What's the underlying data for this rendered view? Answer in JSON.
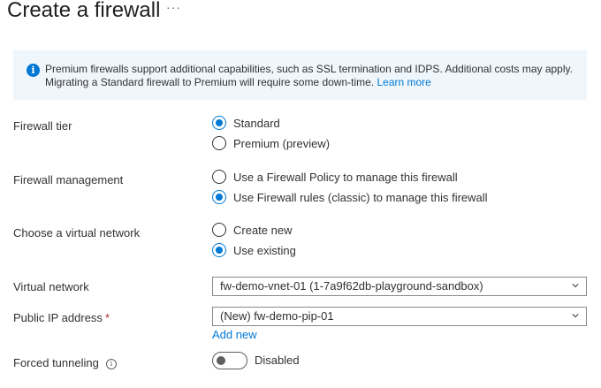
{
  "page": {
    "title": "Create a firewall",
    "more_label": "···"
  },
  "banner": {
    "icon": "info-icon",
    "text": "Premium firewalls support additional capabilities, such as SSL termination and IDPS. Additional costs may apply. Migrating a Standard firewall to Premium will require some down-time.",
    "link": "Learn more"
  },
  "form": {
    "tier": {
      "label": "Firewall tier",
      "options": [
        {
          "label": "Standard",
          "selected": true
        },
        {
          "label": "Premium (preview)",
          "selected": false
        }
      ]
    },
    "management": {
      "label": "Firewall management",
      "options": [
        {
          "label": "Use a Firewall Policy to manage this firewall",
          "selected": false
        },
        {
          "label": "Use Firewall rules (classic) to manage this firewall",
          "selected": true
        }
      ]
    },
    "vnet_choice": {
      "label": "Choose a virtual network",
      "options": [
        {
          "label": "Create new",
          "selected": false
        },
        {
          "label": "Use existing",
          "selected": true
        }
      ]
    },
    "virtual_network": {
      "label": "Virtual network",
      "value": "fw-demo-vnet-01 (1-7a9f62db-playground-sandbox)"
    },
    "public_ip": {
      "label": "Public IP address",
      "required_mark": "*",
      "value": "(New) fw-demo-pip-01",
      "add_new": "Add new"
    },
    "forced_tunneling": {
      "label": "Forced tunneling",
      "info_icon": "info-icon",
      "state_text": "Disabled",
      "enabled": false
    }
  },
  "colors": {
    "accent": "#0078d4",
    "banner_bg": "#eff6fc",
    "required": "#a4262c",
    "text": "#323130"
  }
}
